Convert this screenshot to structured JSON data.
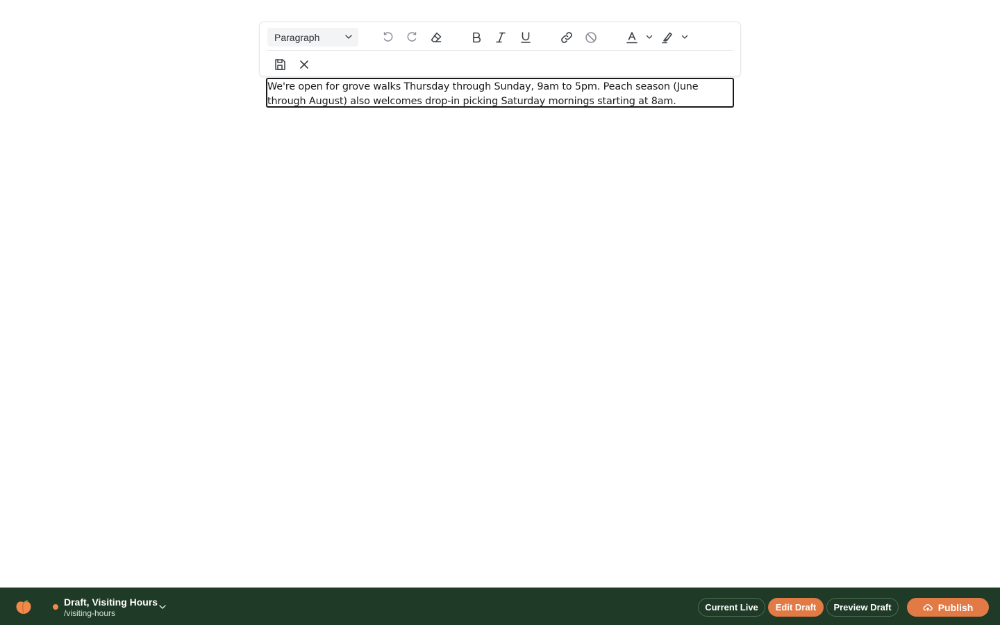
{
  "toolbar": {
    "block_format": {
      "selected": "Paragraph",
      "icon": "chevron-down-icon"
    },
    "buttons": [
      {
        "name": "undo",
        "icon": "undo-icon"
      },
      {
        "name": "redo",
        "icon": "redo-icon"
      },
      {
        "name": "clear-formatting",
        "icon": "eraser-icon"
      },
      {
        "name": "bold",
        "icon": "bold-icon"
      },
      {
        "name": "italic",
        "icon": "italic-icon"
      },
      {
        "name": "underline",
        "icon": "underline-icon"
      },
      {
        "name": "link",
        "icon": "link-icon"
      },
      {
        "name": "unlink",
        "icon": "ban-icon"
      },
      {
        "name": "text-color",
        "icon": "text-color-icon"
      },
      {
        "name": "highlight",
        "icon": "highlighter-icon"
      }
    ],
    "secondary": [
      {
        "name": "save",
        "icon": "save-icon"
      },
      {
        "name": "cancel",
        "icon": "close-icon"
      }
    ]
  },
  "editor": {
    "lines": [
      "We're open for grove walks Thursday through Sunday, 9am to 5pm. Peach season (June",
      "through August) also welcomes drop-in picking Saturday mornings starting at 8am."
    ]
  },
  "bottombar": {
    "logo_icon": "peach-icon",
    "status": "draft",
    "status_color": "#f08a4b",
    "page_title": "Draft, Visiting Hours",
    "page_path": "/visiting-hours",
    "menu_icon": "chevron-down-icon",
    "modes": [
      {
        "label": "Current Live",
        "active": false
      },
      {
        "label": "Edit Draft",
        "active": true
      },
      {
        "label": "Preview Draft",
        "active": false
      }
    ],
    "publish_label": "Publish",
    "publish_icon": "cloud-upload-icon"
  },
  "colors": {
    "bar_background": "#1f3a26",
    "accent": "#e27a45",
    "icon": "#3a3f44"
  }
}
